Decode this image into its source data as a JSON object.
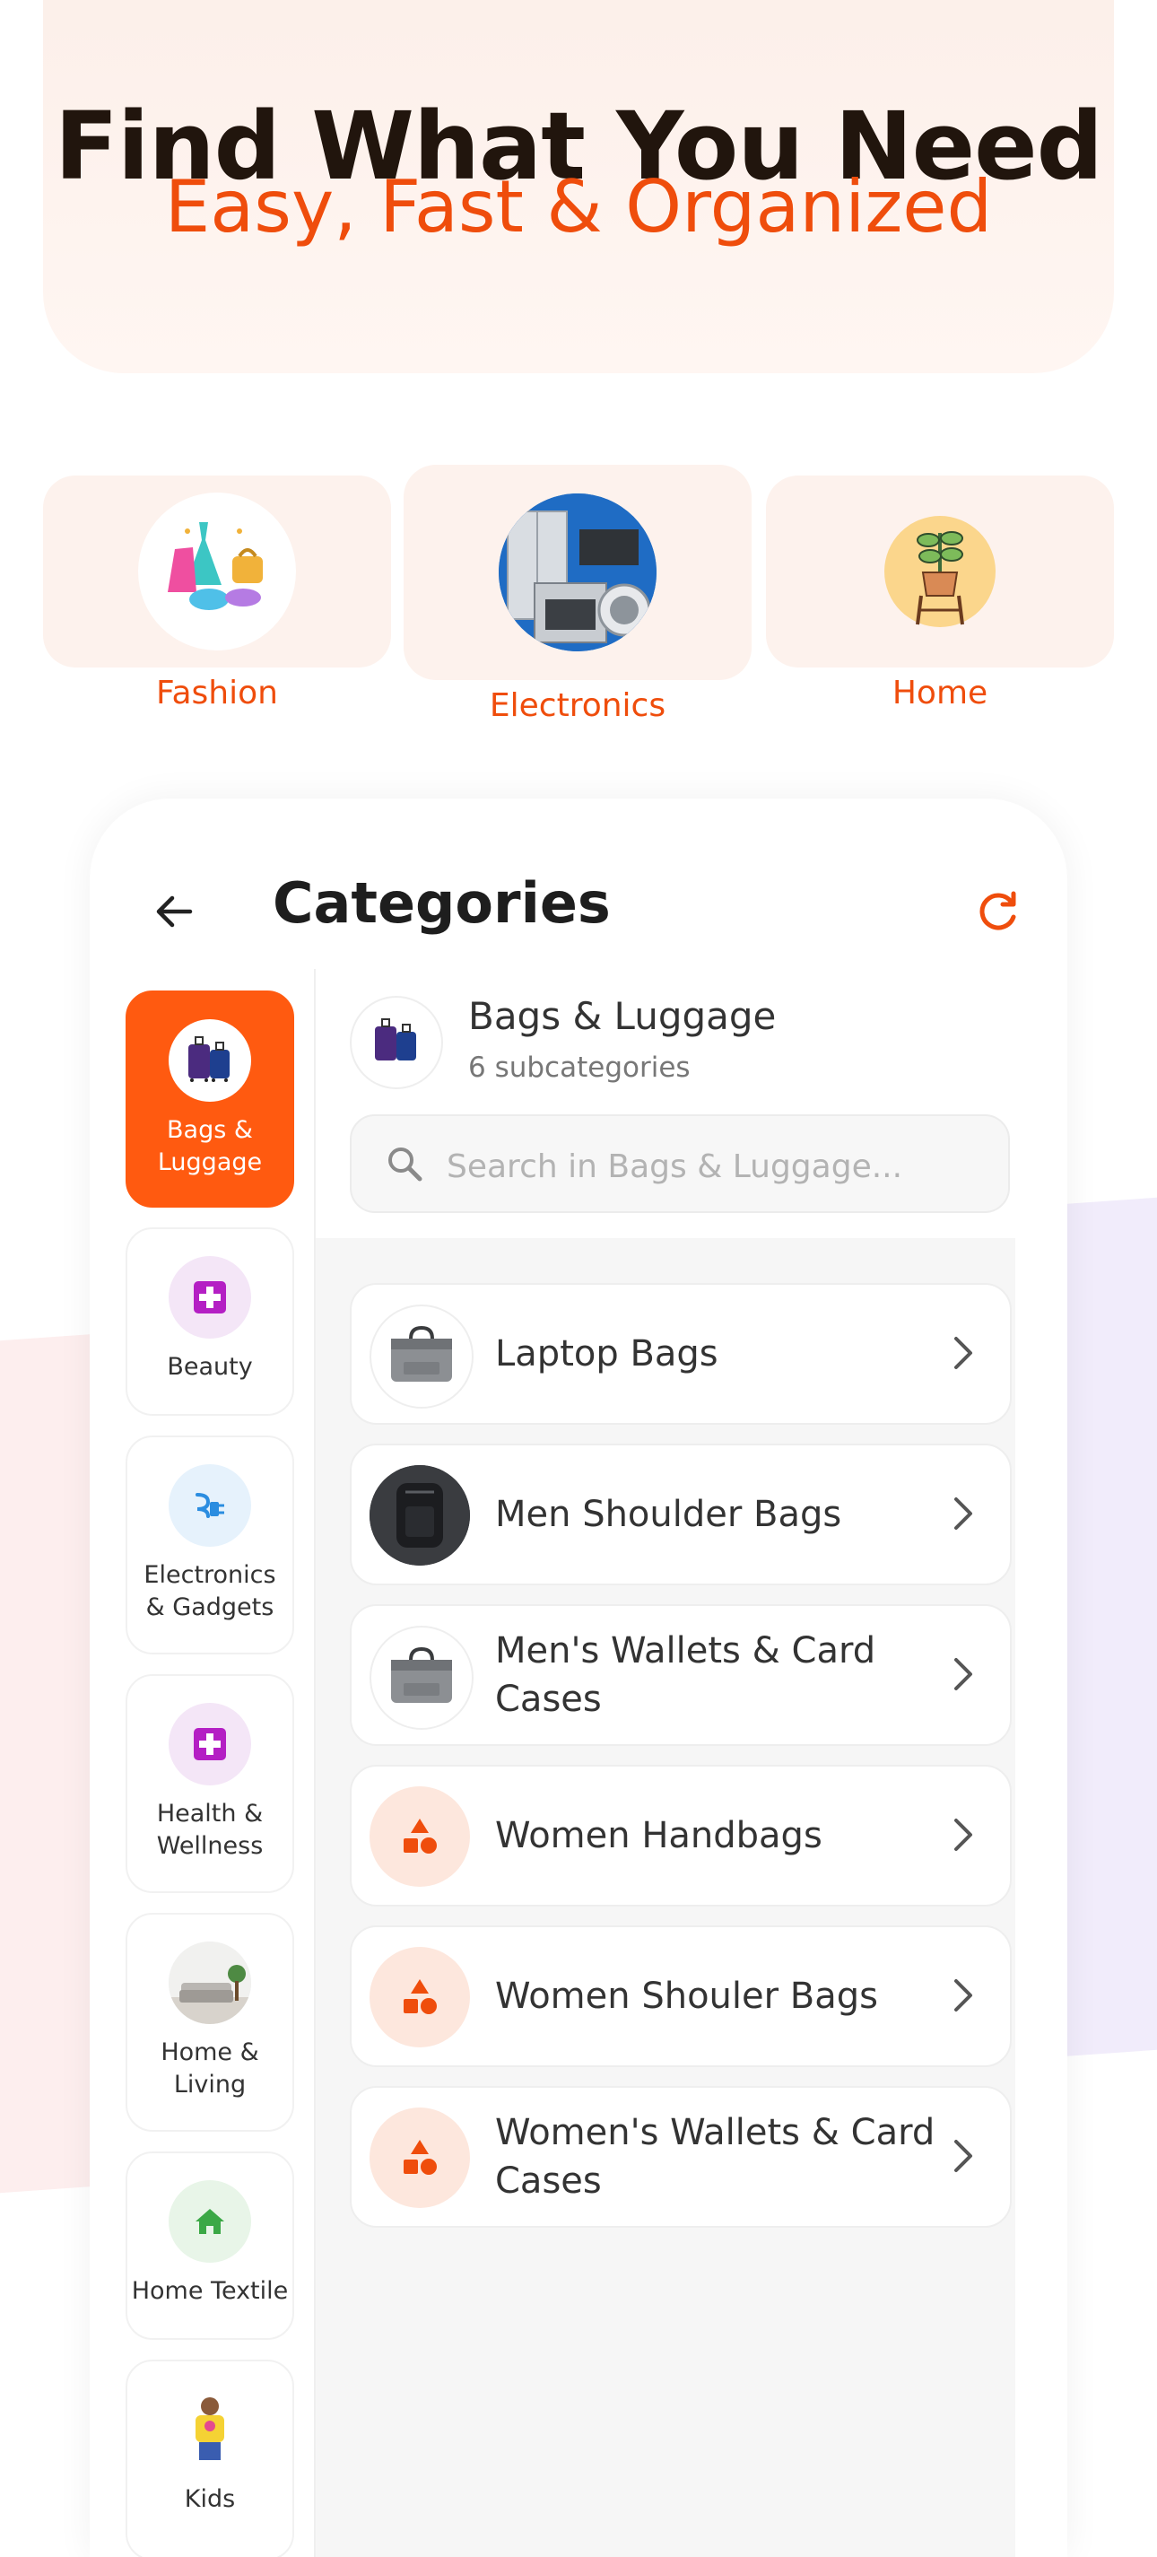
{
  "hero": {
    "title": "Find What You Need",
    "subtitle": "Easy, Fast & Organized"
  },
  "top_categories": [
    {
      "label": "Fashion",
      "icon": "fashion-clothes-icon"
    },
    {
      "label": "Electronics",
      "icon": "appliances-icon"
    },
    {
      "label": "Home",
      "icon": "potted-plant-icon"
    }
  ],
  "header": {
    "title": "Categories",
    "back_icon": "back-arrow-icon",
    "refresh_icon": "refresh-icon"
  },
  "sidebar": {
    "items": [
      {
        "label": "Bags & Luggage",
        "active": true,
        "icon": "luggage-icon"
      },
      {
        "label": "Beauty",
        "active": false,
        "icon": "medical-plus-icon"
      },
      {
        "label": "Electronics & Gadgets",
        "active": false,
        "icon": "plug-icon"
      },
      {
        "label": "Health & Wellness",
        "active": false,
        "icon": "medical-plus-icon"
      },
      {
        "label": "Home & Living",
        "active": false,
        "icon": "sofa-photo-icon"
      },
      {
        "label": "Home Textile",
        "active": false,
        "icon": "house-icon"
      },
      {
        "label": "Kids",
        "active": false,
        "icon": "kid-photo-icon"
      }
    ]
  },
  "selected_category": {
    "title": "Bags & Luggage",
    "subtitle": "6 subcategories"
  },
  "search": {
    "placeholder": "Search in Bags & Luggage..."
  },
  "subcategories": [
    {
      "label": "Laptop Bags",
      "icon": "laptop-bag-photo"
    },
    {
      "label": "Men Shoulder Bags",
      "icon": "backpack-photo"
    },
    {
      "label": "Men's Wallets & Card Cases",
      "icon": "laptop-bag-photo"
    },
    {
      "label": "Women Handbags",
      "icon": "shapes-icon"
    },
    {
      "label": "Women Shouler Bags",
      "icon": "shapes-icon"
    },
    {
      "label": "Women's Wallets & Card Cases",
      "icon": "shapes-icon"
    }
  ],
  "colors": {
    "accent": "#ef4d0c",
    "active_bg": "#ff5a10"
  }
}
